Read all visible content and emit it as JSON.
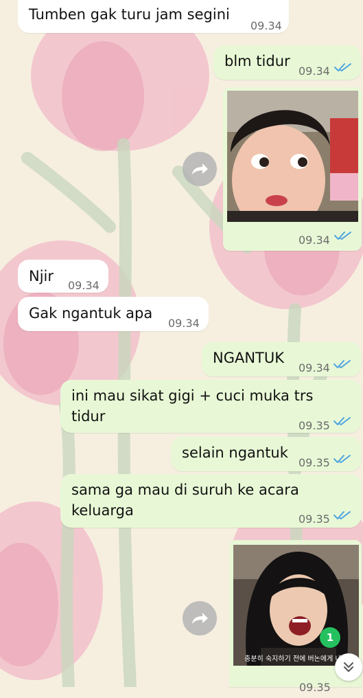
{
  "colors": {
    "incoming_bubble": "#ffffff",
    "outgoing_bubble": "#e8f8d6",
    "read_ticks": "#4fa3e0",
    "badge": "#25c15f",
    "wallpaper": "#f6efe0",
    "tulip": "#f2b9c8"
  },
  "messages": [
    {
      "text": "Tumben gak turu jam segini",
      "time": "09.34",
      "direction": "incoming"
    },
    {
      "text": "blm tidur",
      "time": "09.34",
      "direction": "outgoing",
      "status": "read"
    },
    {
      "type": "image",
      "time": "09.34",
      "direction": "outgoing",
      "status": "read"
    },
    {
      "text": "Njir",
      "time": "09.34",
      "direction": "incoming"
    },
    {
      "text": "Gak ngantuk apa",
      "time": "09.34",
      "direction": "incoming"
    },
    {
      "text": "NGANTUK",
      "time": "09.34",
      "direction": "outgoing",
      "status": "read"
    },
    {
      "text": "ini mau sikat gigi + cuci muka trs\ntidur",
      "time": "09.35",
      "direction": "outgoing",
      "status": "read"
    },
    {
      "text": "selain ngantuk",
      "time": "09.35",
      "direction": "outgoing",
      "status": "read"
    },
    {
      "text": "sama ga mau di suruh ke acara\nkeluarga",
      "time": "09.35",
      "direction": "outgoing",
      "status": "read"
    },
    {
      "type": "image",
      "caption": "충분히 숙지하기 전에 버논에게 내용",
      "time": "09.35",
      "direction": "outgoing",
      "status": "read"
    }
  ],
  "icons": {
    "forward": "forward-arrow-icon",
    "read_receipt": "double-check-icon",
    "scroll_down": "double-chevron-down-icon"
  },
  "unread_badge": "1"
}
